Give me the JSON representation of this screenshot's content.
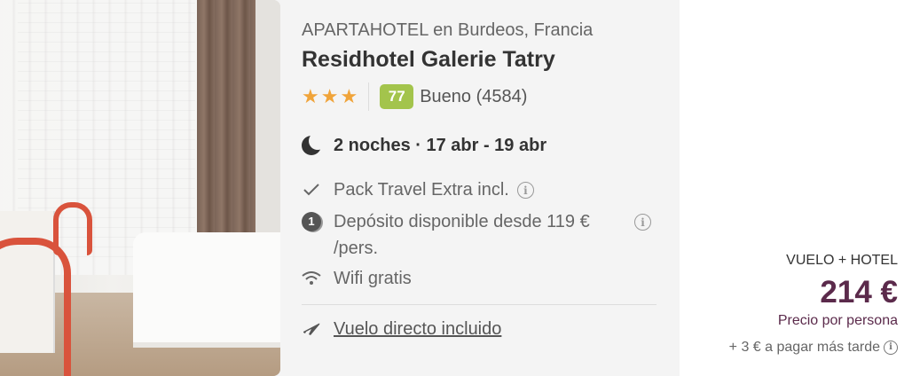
{
  "hotel": {
    "location": "APARTAHOTEL en Burdeos, Francia",
    "name": "Residhotel Galerie Tatry",
    "stars": 3,
    "score": "77",
    "score_label": "Bueno (4584)",
    "dates": "2 noches · 17 abr - 19 abr"
  },
  "features": [
    {
      "icon": "check-icon",
      "text": "Pack Travel Extra incl."
    },
    {
      "icon": "deposit-coin-icon",
      "text": "Depósito disponible desde 119 € /pers."
    },
    {
      "icon": "wifi-icon",
      "text": "Wifi gratis"
    }
  ],
  "flight": {
    "icon": "plane-icon",
    "text": "Vuelo directo incluido"
  },
  "price": {
    "pack_type": "VUELO + HOTEL",
    "amount": "214 €",
    "per_person": "Precio por persona",
    "extra": "+ 3 € a pagar más tarde"
  },
  "colors": {
    "score_bg": "#a3c44c",
    "stars": "#f0a43a",
    "price": "#5b2a4b"
  }
}
